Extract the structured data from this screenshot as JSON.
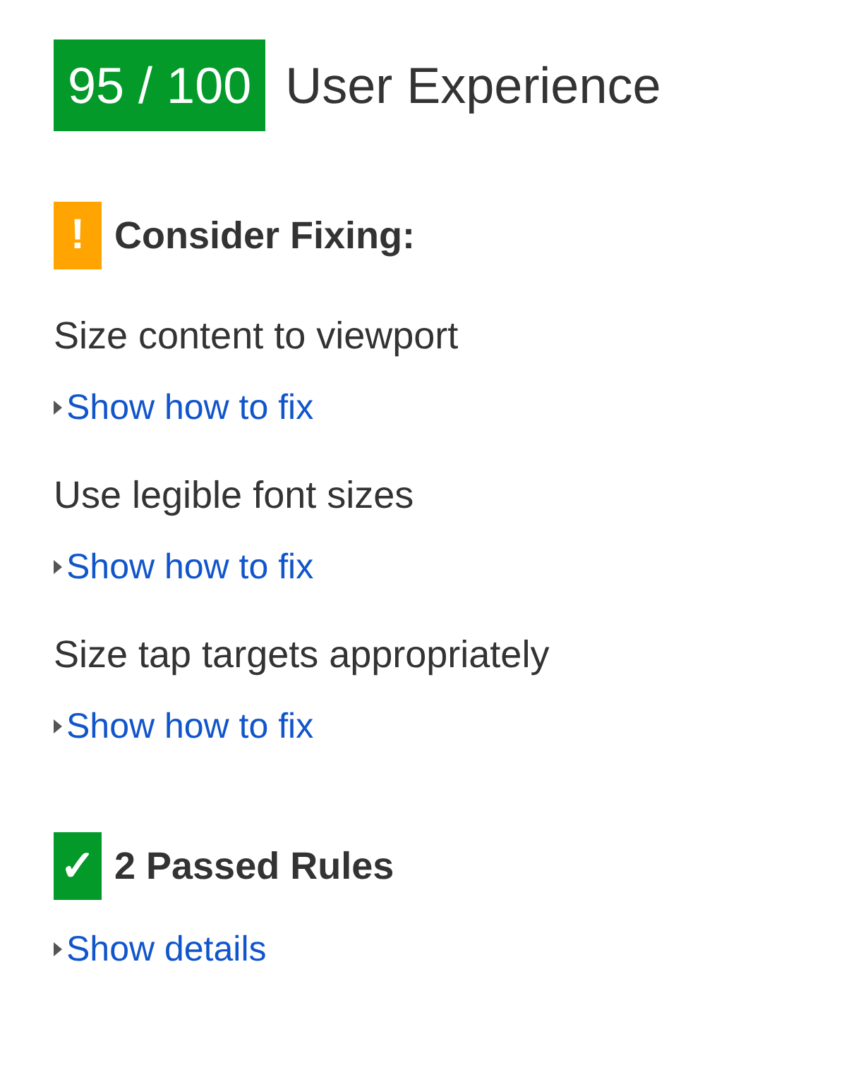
{
  "score": {
    "value": "95 / 100",
    "title": "User Experience"
  },
  "sections": [
    {
      "kind": "warning",
      "icon": "!",
      "heading": "Consider Fixing:",
      "rules": [
        {
          "name": "Size content to viewport",
          "link": "Show how to fix"
        },
        {
          "name": "Use legible font sizes",
          "link": "Show how to fix"
        },
        {
          "name": "Size tap targets appropriately",
          "link": "Show how to fix"
        }
      ]
    },
    {
      "kind": "passed",
      "icon": "✓",
      "heading": "2 Passed Rules",
      "rules": [
        {
          "link": "Show details"
        }
      ]
    }
  ]
}
